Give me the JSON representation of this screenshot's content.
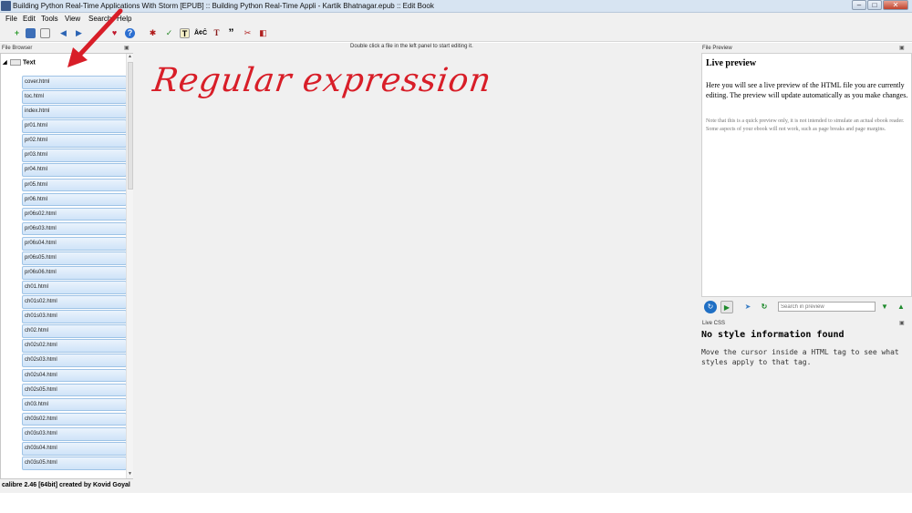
{
  "window": {
    "title": "Building Python Real-Time Applications With Storm [EPUB] :: Building Python Real-Time Appli - Kartik Bhatnagar.epub :: Edit Book",
    "minimize": "–",
    "maximize": "□",
    "close": "✕"
  },
  "menu": {
    "items": [
      "File",
      "Edit",
      "Tools",
      "View",
      "Search",
      "Help"
    ]
  },
  "toolbar": {
    "icons": [
      "new-file-icon",
      "save-icon",
      "check-book-icon",
      "back-icon",
      "forward-icon",
      "reload-icon",
      "heart-icon",
      "help-icon",
      "bug-icon",
      "spellcheck-icon",
      "transform-text-icon",
      "spell-abc-icon",
      "typography-icon",
      "quote-icon",
      "remove-icon",
      "pdf-icon"
    ]
  },
  "file_browser": {
    "title": "File Browser",
    "root": "Text",
    "files": [
      "cover.html",
      "toc.html",
      "index.html",
      "pr01.html",
      "pr02.html",
      "pr03.html",
      "pr04.html",
      "pr05.html",
      "pr06.html",
      "pr06s02.html",
      "pr06s03.html",
      "pr06s04.html",
      "pr06s05.html",
      "pr06s06.html",
      "ch01.html",
      "ch01s02.html",
      "ch01s03.html",
      "ch02.html",
      "ch02s02.html",
      "ch02s03.html",
      "ch02s04.html",
      "ch02s05.html",
      "ch03.html",
      "ch03s02.html",
      "ch03s03.html",
      "ch03s04.html",
      "ch03s05.html"
    ]
  },
  "editor": {
    "hint": "Double click a file in the left panel to start editing it.",
    "annotation": "Regular expression"
  },
  "preview": {
    "panel_title": "File Preview",
    "heading": "Live preview",
    "paragraph1": "Here you will see a live preview of the HTML file you are currently editing. The preview will update automatically as you make changes.",
    "paragraph2": "Note that this is a quick preview only, it is not intended to simulate an actual ebook reader. Some aspects of your ebook will not work, such as page breaks and page margins.",
    "search_placeholder": "Search in preview"
  },
  "live_css": {
    "panel_title": "Live CSS",
    "heading": "No style information found",
    "message": "Move the cursor inside a HTML tag to see what styles apply to that tag."
  },
  "status": {
    "text": "calibre 2.46 [64bit] created by Kovid Goyal"
  },
  "colors": {
    "annotation": "#d81e28",
    "file_item_bg": "#cfe3f8",
    "file_item_border": "#9ec3e6"
  }
}
